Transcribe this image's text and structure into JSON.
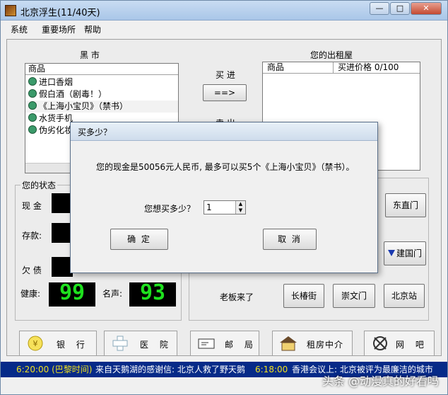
{
  "window": {
    "title": "北京浮生(11/40天)",
    "controls": [
      "—",
      "□",
      "✕"
    ]
  },
  "menu": [
    "系统",
    "重要场所",
    "帮助"
  ],
  "black_market": {
    "title": "黑  市",
    "header": "商品",
    "items": [
      "进口香烟",
      "假白酒（剧毒！）",
      "《上海小宝贝》（禁书）",
      "水货手机",
      "伪劣化妆品"
    ]
  },
  "trade": {
    "buy_label": "买  进",
    "buy_button": "==>",
    "sell_label": "卖  出"
  },
  "rental": {
    "title": "您的出租屋",
    "col_goods": "商品",
    "col_price": "买进价格 0/100"
  },
  "status": {
    "title": "您的状态",
    "cash_label": "现  金",
    "deposit_label": "存款:",
    "debt_label": "欠  债",
    "health_label": "健康:",
    "health_value": "99",
    "fame_label": "名声:",
    "fame_value": "93"
  },
  "locations": {
    "boss_text": "老板来了",
    "buttons": [
      "东直门",
      "建国门",
      "长椿街",
      "崇文门",
      "北京站"
    ]
  },
  "nav": [
    {
      "label": "银  行",
      "icon": "bank-icon"
    },
    {
      "label": "医  院",
      "icon": "hospital-icon"
    },
    {
      "label": "邮  局",
      "icon": "post-office-icon"
    },
    {
      "label": "租房中介",
      "icon": "rental-agency-icon"
    },
    {
      "label": "网  吧",
      "icon": "internet-cafe-icon"
    }
  ],
  "ticker": {
    "time1": "6:20:00 (巴黎时间)",
    "msg1": "来自天鹅湖的感谢信: 北京人救了野天鹅",
    "time2": "6:18:00",
    "msg2": "香港会议上: 北京被评为最廉洁的城市"
  },
  "watermark": "头条 @动漫真的好看吗",
  "dialog": {
    "title": "买多少？",
    "message": "您的现金是50056元人民币, 最多可以买5个《上海小宝贝》（禁书）。",
    "prompt": "您想买多少？",
    "quantity": "1",
    "ok": "确  定",
    "cancel": "取  消"
  },
  "colors": {
    "lcd_green": "#1ee01e",
    "ticker_bg": "#062a88",
    "ticker_time": "#f0e020",
    "ticker_text": "#ffffff"
  }
}
